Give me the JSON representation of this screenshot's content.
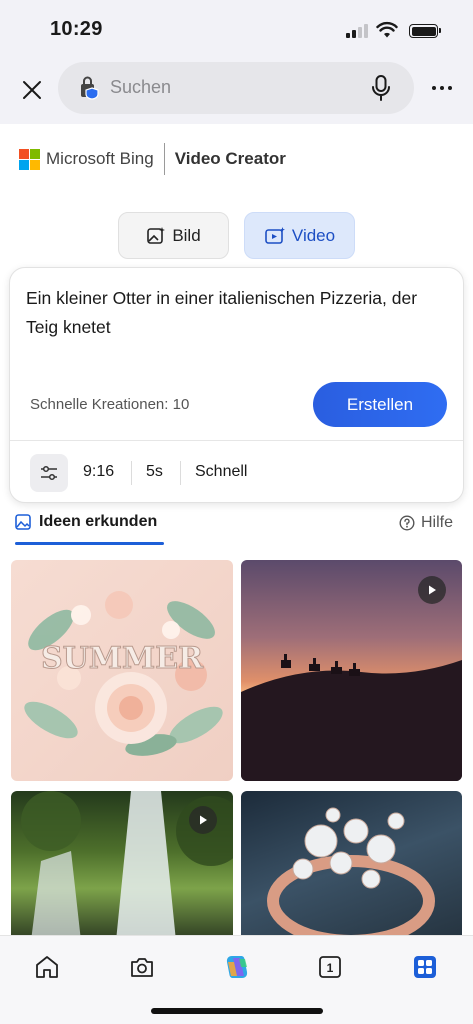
{
  "status_bar": {
    "time": "10:29"
  },
  "browser": {
    "search_placeholder": "Suchen",
    "icons": {
      "close": "close-icon",
      "mic": "microphone-icon",
      "more": "more-icon",
      "lock": "copilot-lock-icon"
    }
  },
  "header": {
    "brand": "Microsoft Bing",
    "product": "Video Creator"
  },
  "mode_toggle": {
    "bild_label": "Bild",
    "video_label": "Video",
    "selected": "Video",
    "accent": "#1d4fc4"
  },
  "prompt_card": {
    "prompt_text": "Ein kleiner Otter in einer italienischen Pizzeria, der Teig knetet",
    "quick_creations": "Schnelle Kreationen: 10",
    "create_label": "Erstellen",
    "options": {
      "aspect": "9:16",
      "duration": "5s",
      "speed": "Schnell"
    }
  },
  "explore": {
    "tab_label": "Ideen erkunden",
    "help_label": "Hilfe"
  },
  "gallery": [
    {
      "name": "summer-paper-flowers",
      "title_art": "SUMMER",
      "has_play": false
    },
    {
      "name": "desert-camels-sunset",
      "has_play": true
    },
    {
      "name": "forest-waterfall",
      "has_play": true
    },
    {
      "name": "pearl-ring",
      "has_play": false
    }
  ],
  "tab_bar": {
    "items": [
      "home-icon",
      "camera-icon",
      "copilot-icon",
      "tabs-icon",
      "apps-icon"
    ],
    "tabs_count": "1",
    "active": "apps-icon",
    "active_color": "#1d5fd8"
  }
}
